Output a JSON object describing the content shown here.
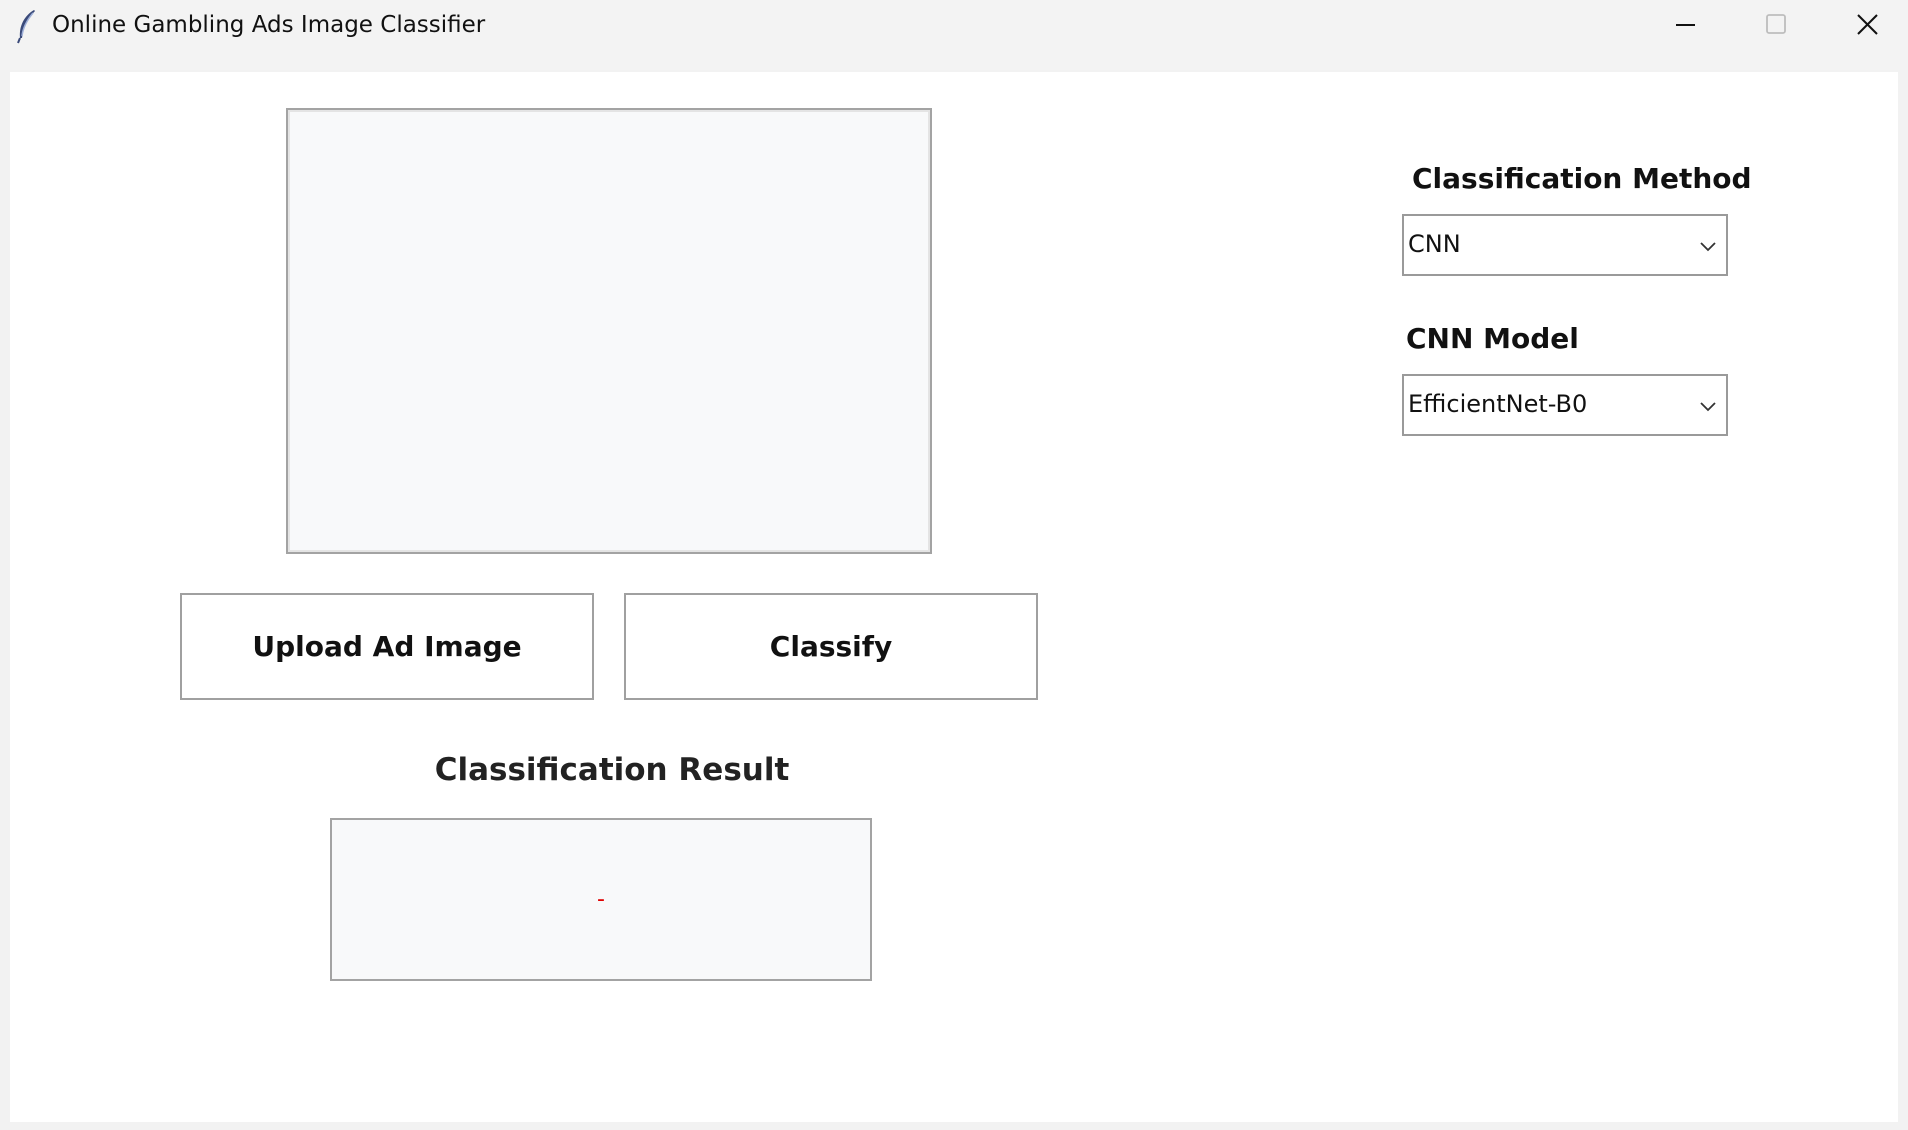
{
  "window": {
    "title": "Online Gambling Ads Image Classifier",
    "icon": "feather-icon"
  },
  "titlebar_controls": {
    "minimize_icon": "minimize-icon",
    "maximize_icon": "maximize-icon",
    "close_icon": "close-icon"
  },
  "actions": {
    "upload_label": "Upload Ad Image",
    "classify_label": "Classify"
  },
  "result": {
    "label": "Classification Result",
    "value": "-",
    "value_color": "#e00000"
  },
  "method": {
    "label": "Classification Method",
    "selected": "CNN"
  },
  "model": {
    "label": "CNN Model",
    "selected": "EfficientNet-B0"
  }
}
